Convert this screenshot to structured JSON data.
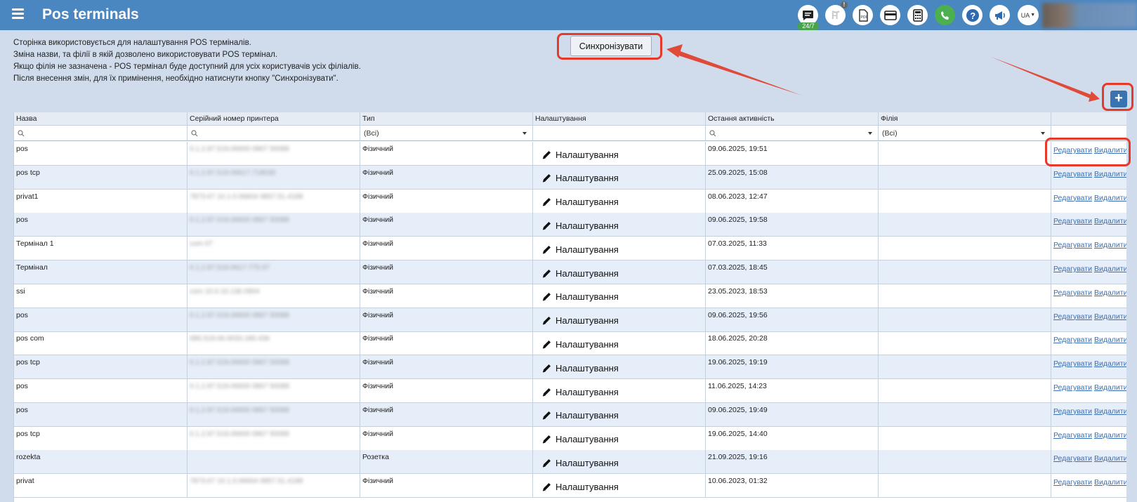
{
  "header": {
    "title": "Pos terminals",
    "badge_247": "24/7",
    "notify": "!",
    "lang": "UA"
  },
  "info_lines": [
    "Сторінка використовується для налаштування POS терміналів.",
    "Зміна назви, та філії в якій дозволено використовувати POS термінал.",
    "Якщо філія не зазначена - POS термінал буде доступний для усіх користувачів усіх філіалів.",
    "Після внесення змін, для їх примінення, необхідно натиснути кнопку \"Синхронізувати\"."
  ],
  "sync_button": "Синхронізувати",
  "add_button": "+",
  "columns": [
    "Назва",
    "Серійний номер принтера",
    "Тип",
    "Налаштування",
    "Остання активність",
    "Філія",
    ""
  ],
  "filters": {
    "type_all": "(Всі)",
    "branch_all": "(Всі)"
  },
  "settings_label": "Налаштування",
  "edit_label": "Редагувати",
  "delete_label": "Видалити",
  "rows": [
    {
      "name": "pos",
      "serial": "0.1.2.87.519.06600 0867 50088",
      "type": "Фізичний",
      "last": "09.06.2025, 19:51",
      "branch": ""
    },
    {
      "name": "pos tcp",
      "serial": "0.1.2.87.519.06617.718030",
      "type": "Фізичний",
      "last": "25.09.2025, 15:08",
      "branch": ""
    },
    {
      "name": "privat1",
      "serial": "7873.67 10.1.0.06604 0857.51.4188",
      "type": "Фізичний",
      "last": "08.06.2023, 12:47",
      "branch": ""
    },
    {
      "name": "pos",
      "serial": "0.1.2.87.519.06600 0867 50088",
      "type": "Фізичний",
      "last": "09.06.2025, 19:58",
      "branch": ""
    },
    {
      "name": "Термінал 1",
      "serial": "com 07",
      "type": "Фізичний",
      "last": "07.03.2025, 11:33",
      "branch": ""
    },
    {
      "name": "Термінал",
      "serial": "0.1.2.87.519.0617.775.57",
      "type": "Фізичний",
      "last": "07.03.2025, 18:45",
      "branch": ""
    },
    {
      "name": "ssi",
      "serial": "com 10.0.10.136.0904",
      "type": "Фізичний",
      "last": "23.05.2023, 18:53",
      "branch": ""
    },
    {
      "name": "pos",
      "serial": "0.1.2.87.519.06600 0867 50088",
      "type": "Фізичний",
      "last": "09.06.2025, 19:56",
      "branch": ""
    },
    {
      "name": "pos com",
      "serial": "086.519.06.0033.180.436",
      "type": "Фізичний",
      "last": "18.06.2025, 20:28",
      "branch": ""
    },
    {
      "name": "pos tcp",
      "serial": "0.1.2.87.519.06600 0867 50088",
      "type": "Фізичний",
      "last": "19.06.2025, 19:19",
      "branch": ""
    },
    {
      "name": "pos",
      "serial": "0.1.2.87.519.06600 0867 50088",
      "type": "Фізичний",
      "last": "11.06.2025, 14:23",
      "branch": ""
    },
    {
      "name": "pos",
      "serial": "0.1.2.87.519.06600 0867 50088",
      "type": "Фізичний",
      "last": "09.06.2025, 19:49",
      "branch": ""
    },
    {
      "name": "pos tcp",
      "serial": "0.1.2.87.519.06600 0867 50088",
      "type": "Фізичний",
      "last": "19.06.2025, 14:40",
      "branch": ""
    },
    {
      "name": "rozekta",
      "serial": "",
      "type": "Розетка",
      "last": "21.09.2025, 19:16",
      "branch": ""
    },
    {
      "name": "privat",
      "serial": "7873.67 10.1.0.06604 0857.51.4188",
      "type": "Фізичний",
      "last": "10.06.2023, 01:32",
      "branch": ""
    }
  ]
}
